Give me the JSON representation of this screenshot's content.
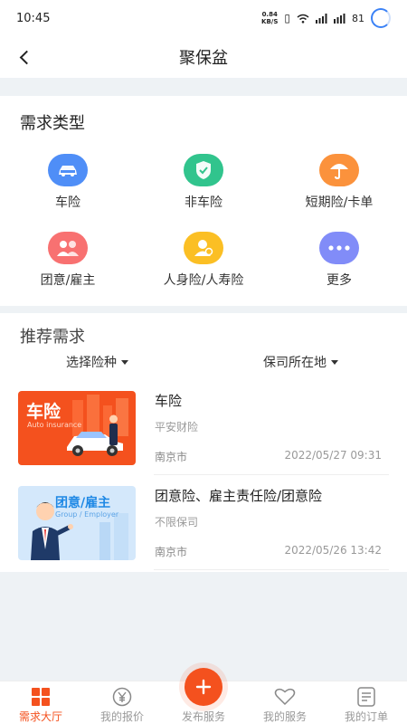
{
  "status_bar": {
    "time": "10:45",
    "net_speed_value": "0.84",
    "net_speed_unit": "KB/S",
    "battery": "81"
  },
  "nav": {
    "title": "聚保盆"
  },
  "demand_types": {
    "title": "需求类型",
    "items": [
      {
        "label": "车险",
        "icon": "car-icon",
        "color": "#4f8ef7"
      },
      {
        "label": "非车险",
        "icon": "shield-icon",
        "color": "#31c48d"
      },
      {
        "label": "短期险/卡单",
        "icon": "umbrella-icon",
        "color": "#fb923c"
      },
      {
        "label": "团意/雇主",
        "icon": "group-icon",
        "color": "#f87171"
      },
      {
        "label": "人身险/人寿险",
        "icon": "person-icon",
        "color": "#fbbf24"
      },
      {
        "label": "更多",
        "icon": "more-icon",
        "color": "#818cf8"
      }
    ]
  },
  "recommend": {
    "title": "推荐需求",
    "filters": {
      "type": "选择险种",
      "location": "保司所在地"
    },
    "items": [
      {
        "title": "车险",
        "company": "平安财险",
        "city": "南京市",
        "date": "2022/05/27 09:31",
        "thumb_title": "车险",
        "thumb_sub": "Auto insurance"
      },
      {
        "title": "团意险、雇主责任险/团意险",
        "company": "不限保司",
        "city": "南京市",
        "date": "2022/05/26 13:42",
        "thumb_title": "团意/雇主",
        "thumb_sub": "Group / Employer"
      }
    ]
  },
  "tabbar": {
    "items": [
      {
        "label": "需求大厅",
        "icon": "grid-icon",
        "active": true
      },
      {
        "label": "我的报价",
        "icon": "yuan-icon",
        "active": false
      },
      {
        "label": "发布服务",
        "icon": "plus-icon",
        "active": false
      },
      {
        "label": "我的服务",
        "icon": "heart-icon",
        "active": false
      },
      {
        "label": "我的订单",
        "icon": "document-icon",
        "active": false
      }
    ]
  },
  "colors": {
    "accent": "#f4511e",
    "page_bg": "#eef2f5"
  }
}
